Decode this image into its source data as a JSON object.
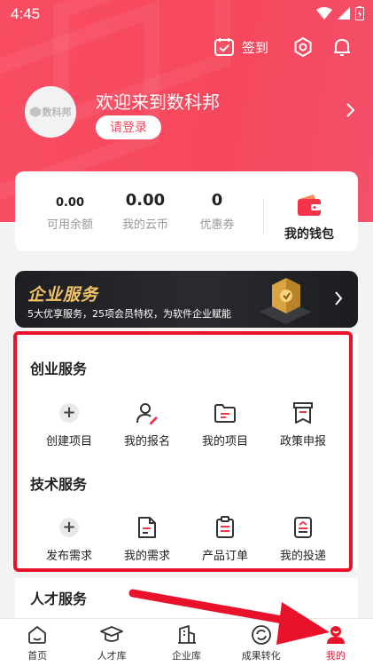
{
  "status_bar": {
    "time": "4:45"
  },
  "header": {
    "checkin_label": "签到"
  },
  "profile": {
    "welcome": "欢迎来到数科邦",
    "login_label": "请登录",
    "avatar_logo": "数科邦"
  },
  "wallet": {
    "stats": [
      {
        "value": "0.00",
        "label": "可用余额"
      },
      {
        "value": "0.00",
        "label": "我的云币"
      },
      {
        "value": "0",
        "label": "优惠券"
      }
    ],
    "my_wallet_label": "我的钱包"
  },
  "banner": {
    "title": "企业服务",
    "subtitle": "5大优享服务，25项会员特权，为软件企业赋能"
  },
  "startup_services": {
    "title": "创业服务",
    "items": [
      {
        "label": "创建项目",
        "icon": "plus-circle-icon"
      },
      {
        "label": "我的报名",
        "icon": "user-edit-icon"
      },
      {
        "label": "我的项目",
        "icon": "folder-icon"
      },
      {
        "label": "政策申报",
        "icon": "policy-icon"
      }
    ]
  },
  "tech_services": {
    "title": "技术服务",
    "items": [
      {
        "label": "发布需求",
        "icon": "plus-circle-icon"
      },
      {
        "label": "我的需求",
        "icon": "document-icon"
      },
      {
        "label": "产品订单",
        "icon": "clipboard-icon"
      },
      {
        "label": "我的投递",
        "icon": "inbox-icon"
      }
    ]
  },
  "talent_services": {
    "title": "人才服务"
  },
  "tabbar": {
    "items": [
      {
        "label": "首页",
        "icon": "home-icon"
      },
      {
        "label": "人才库",
        "icon": "graduation-cap-icon"
      },
      {
        "label": "企业库",
        "icon": "building-icon"
      },
      {
        "label": "成果转化",
        "icon": "cycle-icon"
      },
      {
        "label": "我的",
        "icon": "user-icon",
        "active": true
      }
    ]
  },
  "colors": {
    "brand": "#f4485e",
    "highlight": "#e8132b",
    "banner_gold": "#f2c46a"
  }
}
